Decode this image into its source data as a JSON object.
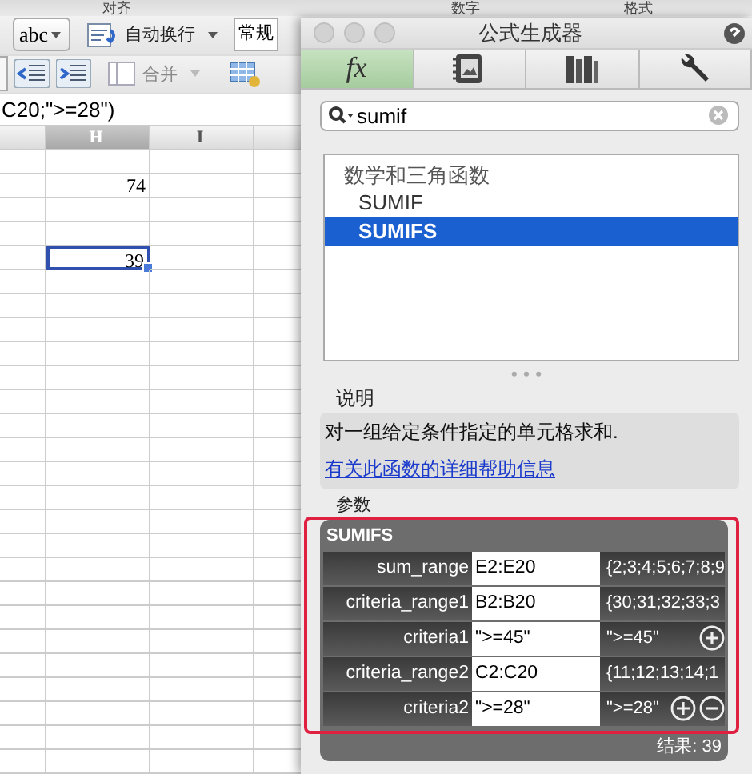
{
  "ribbon": {
    "group_labels": [
      "对齐",
      "数字",
      "格式"
    ],
    "style_button": "abc",
    "wrap_text": "自动换行",
    "number_format": "常规",
    "merge": "合并",
    "merge_disabled": true
  },
  "formula_bar": {
    "text": "C20;\">=28\")"
  },
  "sheet": {
    "columns": [
      {
        "label": "H"
      },
      {
        "label": "I"
      }
    ],
    "rows": [
      {
        "selected": false
      },
      {
        "h": "74",
        "selected": false
      },
      {
        "selected": false
      },
      {
        "selected": false
      },
      {
        "h": "39",
        "selected": true
      }
    ]
  },
  "dialog": {
    "title": "公式生成器",
    "tabs": [
      {
        "kind": "fx",
        "label": "fx",
        "selected": true
      },
      {
        "kind": "notebook",
        "selected": false
      },
      {
        "kind": "books",
        "selected": false
      },
      {
        "kind": "wrench",
        "selected": false
      }
    ],
    "search": {
      "value": "sumif"
    },
    "list": {
      "group": "数学和三角函数",
      "items": [
        {
          "label": "SUMIF",
          "selected": false
        },
        {
          "label": "SUMIFS",
          "selected": true
        }
      ]
    },
    "description": {
      "heading": "说明",
      "text": "对一组给定条件指定的单元格求和.",
      "link": "有关此函数的详细帮助信息"
    },
    "arguments": {
      "heading": "参数",
      "function": "SUMIFS",
      "result": "结果: 39",
      "rows": [
        {
          "name": "sum_range",
          "value": "E2:E20",
          "evaluated": "{2;3;4;5;6;7;8;9",
          "add": false,
          "remove": false
        },
        {
          "name": "criteria_range1",
          "value": "B2:B20",
          "evaluated": "{30;31;32;33;3",
          "add": false,
          "remove": false
        },
        {
          "name": "criteria1",
          "value": "\">=45\"",
          "evaluated": "\">=45\"",
          "add": true,
          "remove": false
        },
        {
          "name": "criteria_range2",
          "value": "C2:C20",
          "evaluated": "{11;12;13;14;1",
          "add": false,
          "remove": false
        },
        {
          "name": "criteria2",
          "value": "\">=28\"",
          "evaluated": "\">=28\"",
          "add": true,
          "remove": true
        }
      ]
    }
  }
}
